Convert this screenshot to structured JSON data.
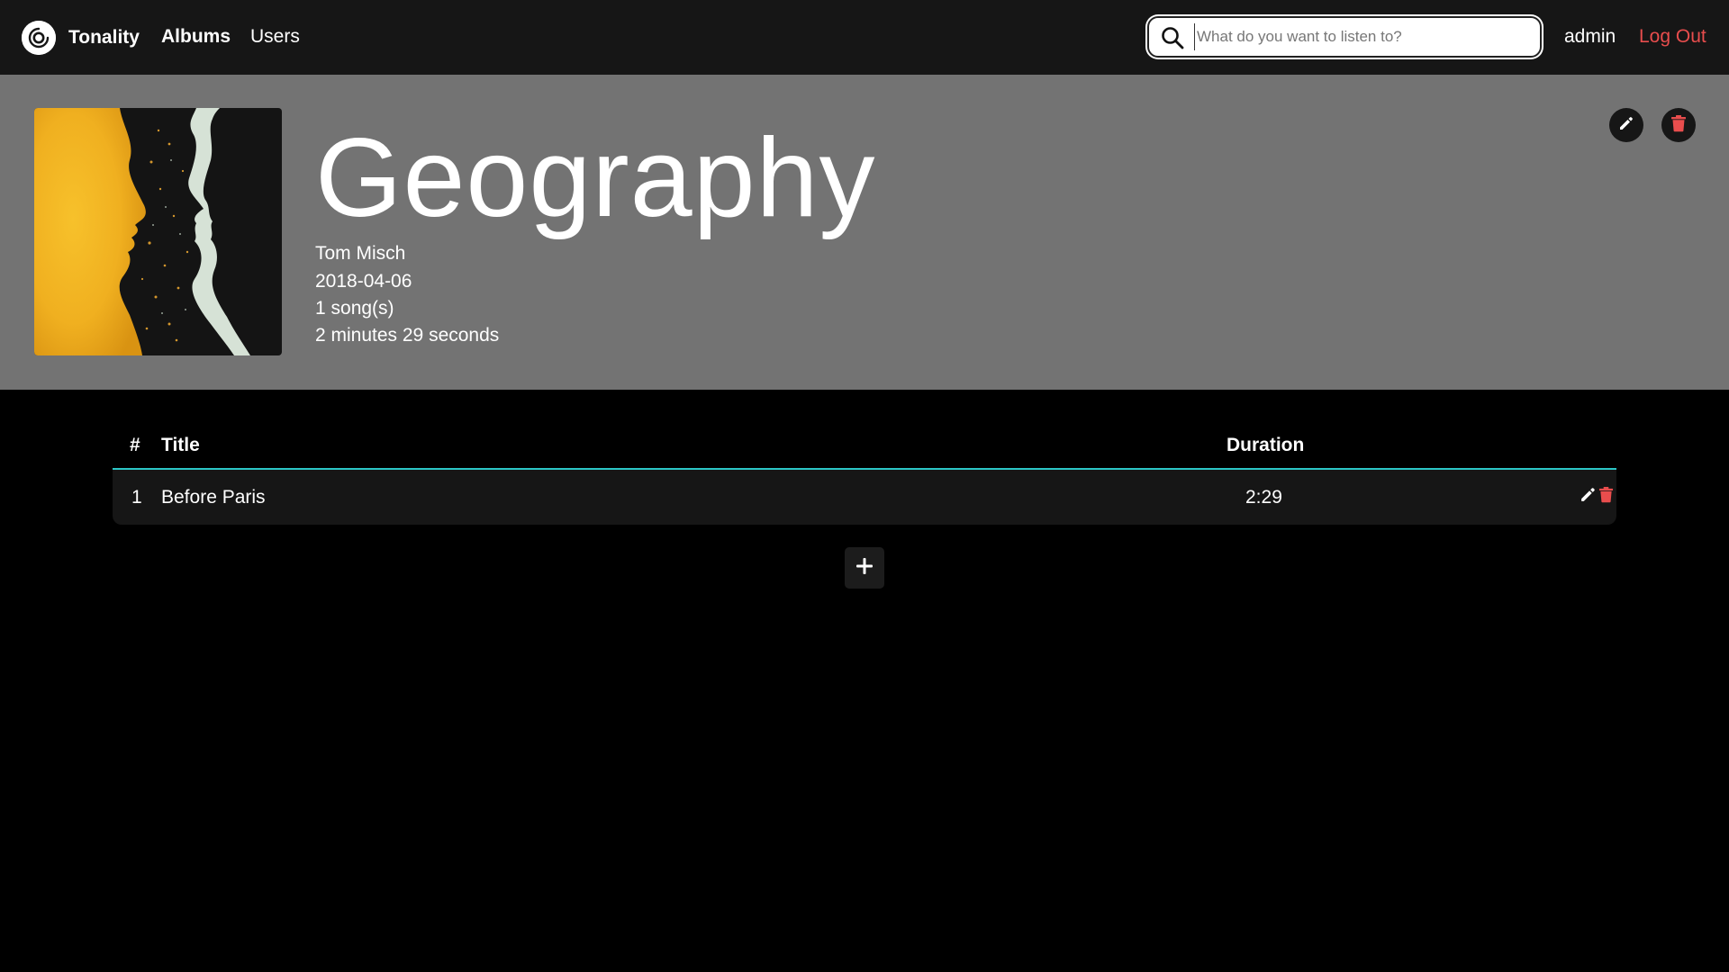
{
  "app": {
    "name": "Tonality"
  },
  "nav": {
    "albums": "Albums",
    "users": "Users"
  },
  "search": {
    "placeholder": "What do you want to listen to?",
    "value": ""
  },
  "user": {
    "name": "admin",
    "logout": "Log Out"
  },
  "album": {
    "title": "Geography",
    "artist": "Tom Misch",
    "release_date": "2018-04-06",
    "song_count": "1 song(s)",
    "duration": "2 minutes 29 seconds"
  },
  "table": {
    "headers": {
      "number": "#",
      "title": "Title",
      "duration": "Duration"
    },
    "rows": [
      {
        "number": "1",
        "title": "Before Paris",
        "duration": "2:29"
      }
    ]
  },
  "colors": {
    "accent": "#2bc6c6",
    "danger": "#e84d4d",
    "hero_bg": "#737373",
    "topbar_bg": "#161616"
  },
  "icons": {
    "logo": "vinyl-record-icon",
    "search": "search-icon",
    "edit": "pencil-icon",
    "delete": "trash-icon",
    "add": "plus-icon"
  }
}
